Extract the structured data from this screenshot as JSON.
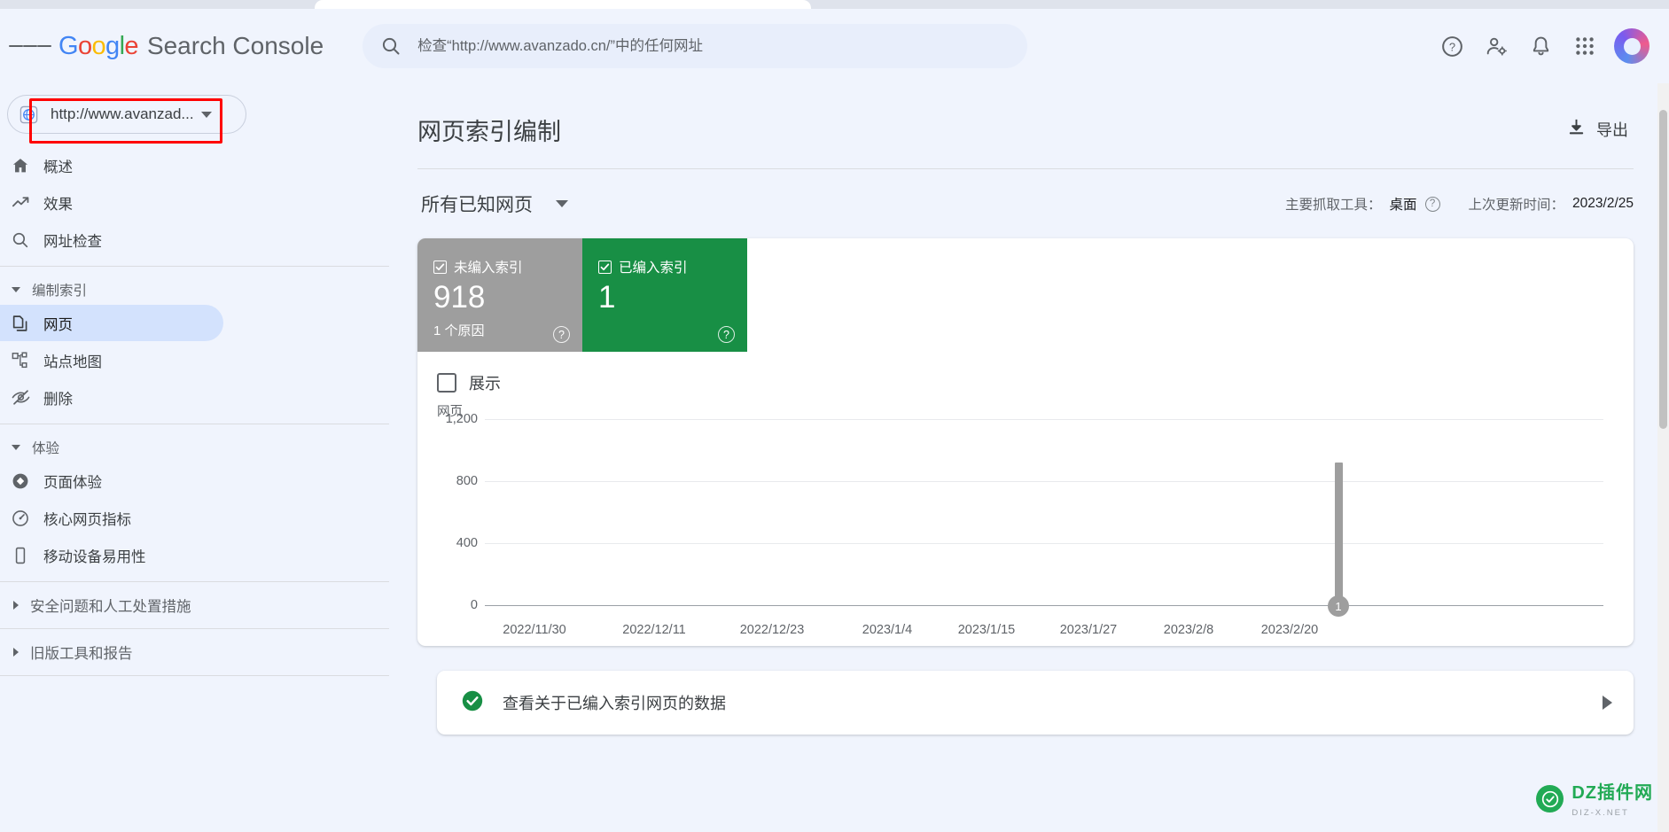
{
  "app": {
    "brand_google": "Google",
    "brand_product": "Search Console"
  },
  "search": {
    "placeholder": "检查“http://www.avanzado.cn/”中的任何网址",
    "value": ""
  },
  "topbar": {
    "help_icon": "help-icon",
    "admin_icon": "account-settings-icon",
    "bell_icon": "notifications-icon",
    "apps_icon": "apps-grid-icon",
    "avatar": "user-avatar"
  },
  "property": {
    "label": "http://www.avanzad...",
    "icon": "globe-icon",
    "highlighted": true,
    "highlight_color": "#ff0000"
  },
  "sidebar": {
    "items": [
      {
        "label": "概述",
        "icon": "home-icon",
        "active": false
      },
      {
        "label": "效果",
        "icon": "trending-up-icon",
        "active": false
      },
      {
        "label": "网址检查",
        "icon": "search-icon",
        "active": false
      }
    ],
    "group_index": {
      "label": "编制索引",
      "expanded": true,
      "items": [
        {
          "label": "网页",
          "icon": "pages-icon",
          "active": true
        },
        {
          "label": "站点地图",
          "icon": "sitemap-icon",
          "active": false
        },
        {
          "label": "删除",
          "icon": "eye-off-icon",
          "active": false
        }
      ]
    },
    "group_experience": {
      "label": "体验",
      "expanded": true,
      "items": [
        {
          "label": "页面体验",
          "icon": "page-experience-icon",
          "active": false
        },
        {
          "label": "核心网页指标",
          "icon": "speedometer-icon",
          "active": false
        },
        {
          "label": "移动设备易用性",
          "icon": "mobile-icon",
          "active": false
        }
      ]
    },
    "group_security": {
      "label": "安全问题和人工处置措施",
      "expanded": false
    },
    "group_legacy": {
      "label": "旧版工具和报告",
      "expanded": false
    }
  },
  "main": {
    "title": "网页索引编制",
    "export_label": "导出",
    "export_icon": "download-icon",
    "filter_label": "所有已知网页",
    "meta": {
      "crawler_label": "主要抓取工具：",
      "crawler_value": "桌面",
      "updated_label": "上次更新时间：",
      "updated_value": "2023/2/25"
    },
    "stats": [
      {
        "name": "未编入索引",
        "value": "918",
        "sub": "1 个原因",
        "color": "#9e9e9e",
        "checked": true
      },
      {
        "name": "已编入索引",
        "value": "1",
        "sub": "",
        "color": "#188f45",
        "checked": true
      }
    ],
    "legend": {
      "label": "展示",
      "checked": false
    },
    "info_card": {
      "text": "查看关于已编入索引网页的数据",
      "icon": "check-circle-icon",
      "icon_color": "#188f45"
    }
  },
  "chart_data": {
    "type": "bar",
    "title": "",
    "ylabel": "网页",
    "xlabel": "",
    "ylim": [
      0,
      1200
    ],
    "yticks": [
      "0",
      "400",
      "800",
      "1,200"
    ],
    "ytick_values": [
      0,
      400,
      800,
      1200
    ],
    "grid": true,
    "legend_position": "top-left",
    "xtick_labels": [
      "2022/11/30",
      "2022/12/11",
      "2022/12/23",
      "2023/1/4",
      "2023/1/15",
      "2023/1/27",
      "2023/2/8",
      "2023/2/20"
    ],
    "series": [
      {
        "name": "未编入索引",
        "color": "#9e9e9e",
        "points": [
          {
            "x": "2023/2/23",
            "value": 918,
            "label": "1"
          }
        ]
      },
      {
        "name": "已编入索引",
        "color": "#188f45",
        "points": []
      }
    ],
    "notes": "Single gray bar near the right edge of the plot reaching ~918 pages, with a circular badge labelled 1 at its base."
  },
  "watermark": {
    "title": "DZ插件网",
    "subtitle": "DIZ-X.NET"
  }
}
